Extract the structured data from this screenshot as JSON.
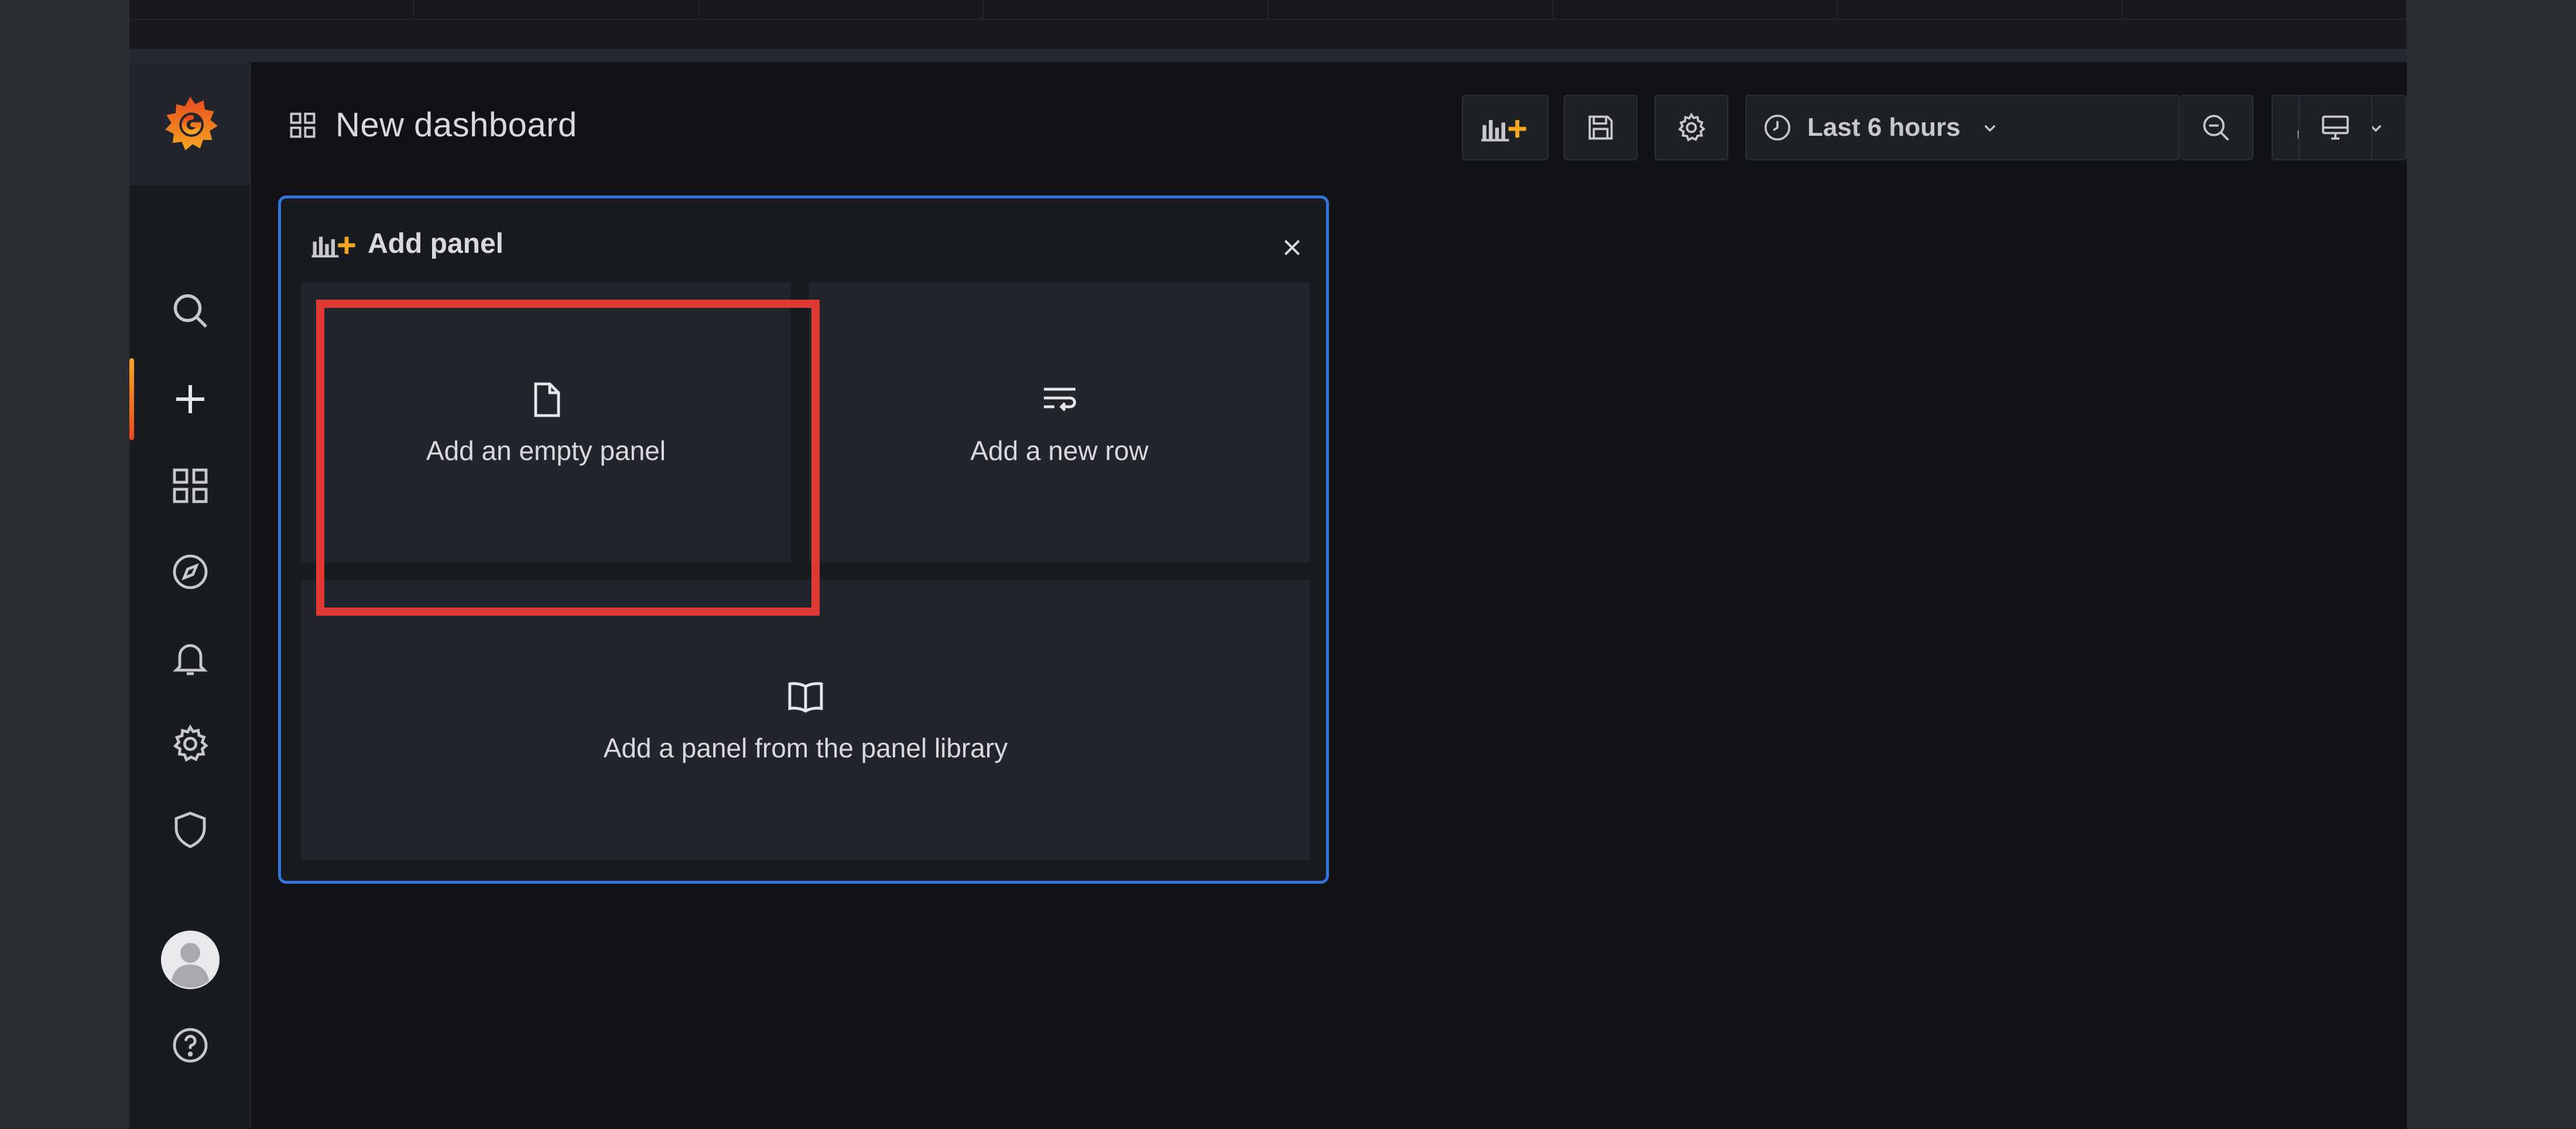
{
  "header": {
    "title": "New dashboard",
    "title_icon": "dashboard-grid-icon"
  },
  "toolbar": {
    "add_panel_icon": "add-panel-icon",
    "save_icon": "save-icon",
    "settings_icon": "gear-icon",
    "time_range_label": "Last 6 hours",
    "time_icon": "clock-icon",
    "zoom_out_icon": "zoom-out-icon",
    "refresh_icon": "refresh-icon",
    "refresh_dropdown_icon": "chevron-down-icon",
    "tv_mode_icon": "monitor-icon"
  },
  "sidebar": {
    "logo": "grafana-logo",
    "items": [
      {
        "name": "search",
        "icon": "search-icon"
      },
      {
        "name": "create",
        "icon": "plus-icon",
        "active": true
      },
      {
        "name": "dashboards",
        "icon": "apps-grid-icon"
      },
      {
        "name": "explore",
        "icon": "compass-icon"
      },
      {
        "name": "alerting",
        "icon": "bell-icon"
      },
      {
        "name": "configuration",
        "icon": "gear-icon"
      },
      {
        "name": "server-admin",
        "icon": "shield-icon"
      }
    ],
    "bottom": [
      {
        "name": "profile",
        "icon": "avatar"
      },
      {
        "name": "help",
        "icon": "help-icon"
      }
    ]
  },
  "add_panel": {
    "title": "Add panel",
    "options": [
      {
        "label": "Add an empty panel",
        "icon": "file-icon"
      },
      {
        "label": "Add a new row",
        "icon": "row-icon"
      },
      {
        "label": "Add a panel from the panel library",
        "icon": "book-icon"
      }
    ]
  },
  "colors": {
    "accent_blue": "#3274d9",
    "highlight_red": "#e03a34",
    "brand_orange": "#f5a623"
  }
}
